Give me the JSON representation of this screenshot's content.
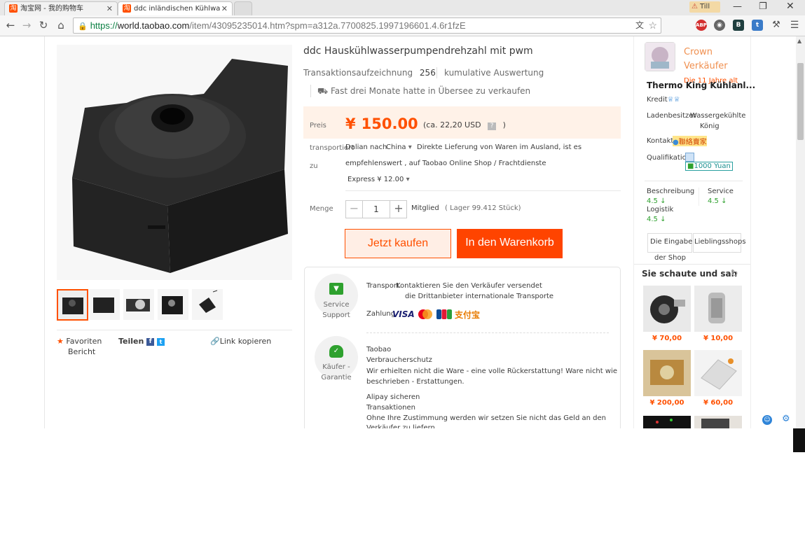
{
  "browser": {
    "tabs": [
      {
        "title": "淘宝网 - 我的购物车"
      },
      {
        "title": "ddc inländischen Kühlwa"
      }
    ],
    "url_scheme": "https://",
    "url_host": "world.taobao.com",
    "url_path": "/item/43095235014.htm?spm=a312a.7700825.1997196601.4.6r1fzE",
    "user": "Till"
  },
  "product": {
    "title": "ddc Hauskühlwasserpumpendrehzahl mit pwm",
    "transactions_label": "Transaktionsaufzeichnung",
    "transactions_count": "256",
    "reviews_label": "kumulative Auswertung",
    "overseas_note": "Fast drei Monate hatte in Übersee zu verkaufen",
    "price_label": "Preis",
    "price_currency": "¥",
    "price_value": "150.00",
    "price_usd": "(ca. 22,20 USD",
    "price_usd_close": ")",
    "ship_label": "transportiert",
    "ship_label2": "zu",
    "ship_from": "Dalian nach",
    "ship_country": "China",
    "ship_note1": "Direkte Lieferung von Waren im Ausland, ist es",
    "ship_note2": "empfehlenswert , auf Taobao Online Shop / Frachtdienste",
    "ship_express": "Express ¥ 12.00",
    "qty_label": "Menge",
    "qty_value": "1",
    "qty_unit": "Mitglied",
    "stock": "( Lager 99.412 Stück)",
    "buy_now": "Jetzt kaufen",
    "add_cart": "In den Warenkorb"
  },
  "service": {
    "support_label1": "Service",
    "support_label2": "Support",
    "transport_label": "Transport",
    "transport_text1": "Kontaktieren Sie den Verkäufer versendet",
    "transport_text2": "die Drittanbieter internationale Transporte",
    "payment_label": "Zahlung",
    "pay_visa": "VISA",
    "pay_alipay": "支付宝",
    "buyer_label1": "Käufer -",
    "buyer_label2": "Garantie",
    "g1": "Taobao",
    "g2": "Verbraucherschutz",
    "g3": "Wir erhielten nicht die Ware - eine volle Rückerstattung! Ware nicht wie",
    "g4": "beschrieben - Erstattungen.",
    "g5": "Alipay sicheren",
    "g6": "Transaktionen",
    "g7": "Ohne Ihre Zustimmung werden wir setzen Sie nicht das Geld an den",
    "g8": "Verkäufer zu liefern"
  },
  "social": {
    "favorites": "Favoriten",
    "report": "Bericht",
    "share": "Teilen",
    "copy_link": "Link kopieren"
  },
  "seller": {
    "name1": "Crown",
    "name2": "Verkäufer",
    "age": "Die 11 Jahre alt",
    "shop_name": "Thermo King Kühlanl...",
    "credit_label": "Kredit",
    "owner_label": "Ladenbesitzer",
    "owner_value1": "Wassergekühlte",
    "owner_value2": "König",
    "contact_label": "Kontakt",
    "contact_value": "聯絡賣家",
    "qual_label": "Qualifikation",
    "qual_value": "1000 Yuan",
    "rating_desc_label": "Beschreibung",
    "rating_desc": "4.5",
    "rating_service_label": "Service",
    "rating_service": "4.5",
    "rating_log_label": "Logistik",
    "rating_log": "4.5",
    "enter_shop1": "Die Eingabe",
    "enter_shop2": "der Shop",
    "fav_shop": "Lieblingsshops"
  },
  "recommend": {
    "title": "Sie schaute und sah",
    "items": [
      {
        "price": "¥ 70,00"
      },
      {
        "price": "¥ 10,00"
      },
      {
        "price": "¥ 200,00"
      },
      {
        "price": "¥ 60,00"
      }
    ]
  }
}
